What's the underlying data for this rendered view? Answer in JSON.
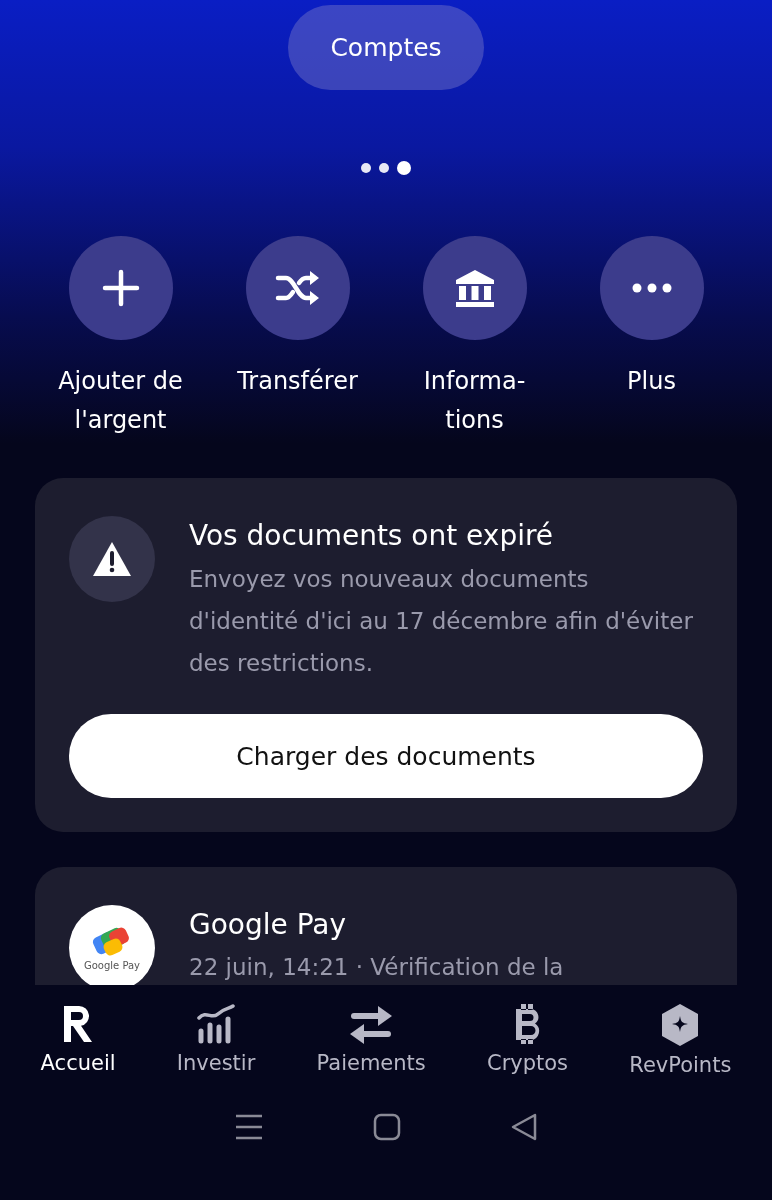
{
  "header": {
    "accounts_button": "Comptes"
  },
  "pager": [
    {
      "selected": false
    },
    {
      "selected": false
    },
    {
      "selected": true
    }
  ],
  "actions": [
    {
      "kind": "add",
      "label": "Ajouter de l'argent"
    },
    {
      "kind": "transfer",
      "label": "Transférer"
    },
    {
      "kind": "bank",
      "label": "Informa-tions"
    },
    {
      "kind": "more",
      "label": "Plus"
    }
  ],
  "alert": {
    "title": "Vos documents ont expiré",
    "body": "Envoyez vos nouveaux documents d'identité d'ici au 17 décembre afin d'éviter des restrictions.",
    "button": "Charger des documents"
  },
  "transaction": {
    "logo_caption": "Google Pay",
    "title": "Google Pay",
    "subtitle": "22 juin, 14:21 · Vérification de la"
  },
  "tabs": [
    {
      "kind": "home",
      "label": "Accueil",
      "selected": true
    },
    {
      "kind": "invest",
      "label": "Investir",
      "selected": false
    },
    {
      "kind": "payments",
      "label": "Paiements",
      "selected": false
    },
    {
      "kind": "crypto",
      "label": "Cryptos",
      "selected": false
    },
    {
      "kind": "points",
      "label": "RevPoints",
      "selected": false
    }
  ]
}
